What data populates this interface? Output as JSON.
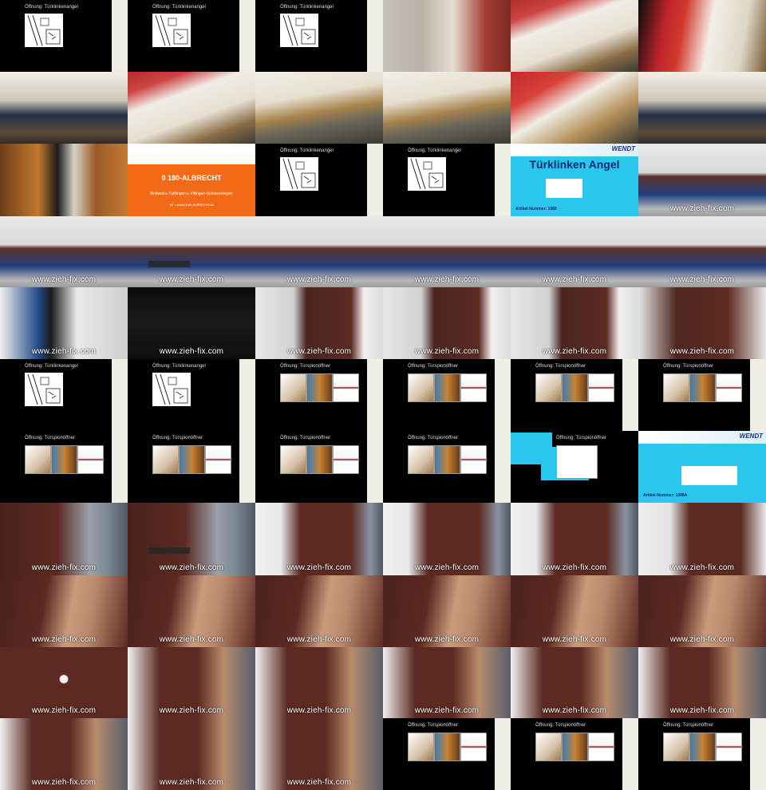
{
  "texts": {
    "slide_tuerklinke": "Öffnung: Türklinkenangel",
    "slide_spion": "Öffnung: Türspionöffner",
    "watermark": "www.zieh-fix.com",
    "product_tuerklinke": "Türklinken Angel",
    "product_number_1080": "Artikel-Nummer: 1080",
    "product_number_1088a": "Artikel-Nummer: 1088A",
    "brand": "WENDT",
    "business_number": "0 180-ALBRECHT",
    "business_cities": "Rottweil ▸ Tuttlingen ▸ Villingen-Schwenningen",
    "business_web": "Tel. • www.0180-ALBRECHT.de"
  },
  "colors": {
    "frame_black": "#000000",
    "bar_cream": "#eeeee2",
    "product_cyan": "#29c6ee",
    "business_orange": "#f26a16",
    "door_brown": "#5c2a22"
  },
  "frames": [
    {
      "kind": "slide-tk",
      "bars": "cream"
    },
    {
      "kind": "slide-tk",
      "bars": "cream"
    },
    {
      "kind": "slide-tk",
      "bars": "cream"
    },
    {
      "kind": "video",
      "scene": "woman-phone"
    },
    {
      "kind": "video",
      "scene": "threshold-closeup"
    },
    {
      "kind": "video",
      "scene": "door-red-sleeve"
    },
    {
      "kind": "video",
      "scene": "kneeling-man"
    },
    {
      "kind": "video",
      "scene": "threshold-closeup"
    },
    {
      "kind": "video",
      "scene": "threshold-tool"
    },
    {
      "kind": "video",
      "scene": "threshold-tool"
    },
    {
      "kind": "video",
      "scene": "threshold-red"
    },
    {
      "kind": "video",
      "scene": "kneeling-man"
    },
    {
      "kind": "video",
      "scene": "man-wood-door"
    },
    {
      "kind": "business"
    },
    {
      "kind": "slide-tk",
      "bars": "cream"
    },
    {
      "kind": "slide-tk",
      "bars": "cream"
    },
    {
      "kind": "product",
      "product": "tk"
    },
    {
      "kind": "video",
      "scene": "hallway-blue",
      "wm": true
    },
    {
      "kind": "video",
      "scene": "hallway-blue",
      "wm": true
    },
    {
      "kind": "video",
      "scene": "hallway-blue",
      "wm": true,
      "player": true
    },
    {
      "kind": "video",
      "scene": "hallway-blue",
      "wm": true
    },
    {
      "kind": "video",
      "scene": "hallway-blue",
      "wm": true
    },
    {
      "kind": "video",
      "scene": "hallway-blue",
      "wm": true
    },
    {
      "kind": "video",
      "scene": "hallway-blue",
      "wm": true
    },
    {
      "kind": "video",
      "scene": "hallway-leaving",
      "wm": true
    },
    {
      "kind": "video",
      "scene": "dark",
      "wm": true
    },
    {
      "kind": "video",
      "scene": "door-handle",
      "wm": true
    },
    {
      "kind": "video",
      "scene": "door-handle",
      "wm": true
    },
    {
      "kind": "video",
      "scene": "door-handle",
      "wm": true
    },
    {
      "kind": "video",
      "scene": "door-handle-open",
      "wm": true
    },
    {
      "kind": "slide-tk",
      "bars": "cream"
    },
    {
      "kind": "slide-tk",
      "bars": "cream"
    },
    {
      "kind": "slide-sp",
      "bars": "cream"
    },
    {
      "kind": "slide-sp",
      "bars": "cream"
    },
    {
      "kind": "slide-sp",
      "bars": "cream"
    },
    {
      "kind": "slide-sp",
      "bars": "cream"
    },
    {
      "kind": "slide-sp",
      "bars": "cream"
    },
    {
      "kind": "slide-sp",
      "bars": "cream"
    },
    {
      "kind": "slide-sp",
      "bars": "cream"
    },
    {
      "kind": "slide-sp",
      "bars": "cream"
    },
    {
      "kind": "slide-sp-transition"
    },
    {
      "kind": "product",
      "product": "sp"
    },
    {
      "kind": "video",
      "scene": "man-brown-door",
      "wm": true
    },
    {
      "kind": "video",
      "scene": "man-brown-door",
      "wm": true,
      "player": true
    },
    {
      "kind": "video",
      "scene": "man-brown-door-right",
      "wm": true
    },
    {
      "kind": "video",
      "scene": "man-brown-door-right",
      "wm": true
    },
    {
      "kind": "video",
      "scene": "man-brown-door-right",
      "wm": true
    },
    {
      "kind": "video",
      "scene": "brown-door-plain",
      "wm": true
    },
    {
      "kind": "video",
      "scene": "door-hands",
      "wm": true
    },
    {
      "kind": "video",
      "scene": "door-hands",
      "wm": true
    },
    {
      "kind": "video",
      "scene": "door-hands",
      "wm": true
    },
    {
      "kind": "video",
      "scene": "door-hands",
      "wm": true
    },
    {
      "kind": "video",
      "scene": "door-hands",
      "wm": true
    },
    {
      "kind": "video",
      "scene": "door-hands",
      "wm": true
    },
    {
      "kind": "video",
      "scene": "peephole",
      "wm": true
    },
    {
      "kind": "video",
      "scene": "door-inset",
      "wm": true
    },
    {
      "kind": "video",
      "scene": "door-inset",
      "wm": true
    },
    {
      "kind": "video",
      "scene": "door-inset",
      "wm": true
    },
    {
      "kind": "video",
      "scene": "door-inset",
      "wm": true
    },
    {
      "kind": "video",
      "scene": "door-inset",
      "wm": true
    },
    {
      "kind": "video",
      "scene": "door-inset",
      "wm": true
    },
    {
      "kind": "video",
      "scene": "door-inset",
      "wm": true
    },
    {
      "kind": "video",
      "scene": "door-inset",
      "wm": true
    },
    {
      "kind": "slide-sp",
      "bars": "cream"
    },
    {
      "kind": "slide-sp",
      "bars": "cream"
    },
    {
      "kind": "slide-sp",
      "bars": "cream"
    }
  ]
}
